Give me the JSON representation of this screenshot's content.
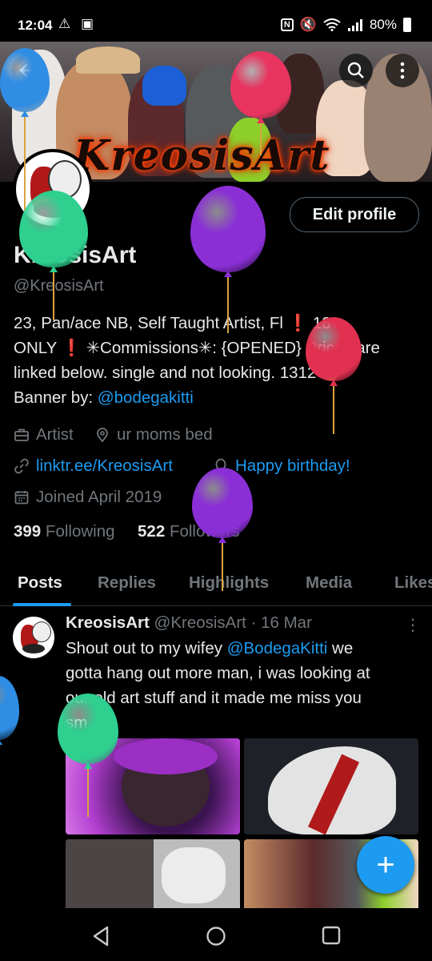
{
  "status_bar": {
    "time": "12:04",
    "left_icons": "⚠ ▣",
    "nfc": "N",
    "battery": "80%"
  },
  "banner": {
    "title": "KreosisArt",
    "back_icon": "back-arrow-icon",
    "search_icon": "search-icon",
    "more_icon": "more-icon"
  },
  "profile": {
    "display_name": "KreosisArt",
    "handle": "@KreosisArt",
    "edit_label": "Edit profile",
    "bio_line1": "23, Pan/ace NB, Self Taught Artist, Fl",
    "bio_line1_b": "❗ 18+",
    "bio_line2": "ONLY ❗ ✳Commissions✳: {OPENED} Prices are",
    "bio_line3": "linked below. single and not looking. 1312 ✊",
    "bio_banner_prefix": "Banner by: ",
    "bio_banner_link": "@bodegakitti",
    "category": "Artist",
    "location": "ur moms bed",
    "website": "linktr.ee/KreosisArt",
    "birthday": "Happy birthday!",
    "joined": "Joined April 2019",
    "following_count": "399",
    "following_label": "Following",
    "followers_count": "522",
    "followers_label": "Followers"
  },
  "tabs": [
    "Posts",
    "Replies",
    "Highlights",
    "Media",
    "Likes"
  ],
  "tweet": {
    "name": "KreosisArt",
    "meta": "@KreosisArt · 16 Mar",
    "text_line1": "Shout out to my wifey ",
    "mention": "@BodegaKitti",
    "text_line1_end": " we",
    "text_line2": "gotta hang out more man, i was looking at",
    "text_line3": "our old art stuff and it made me miss you",
    "text_line4": "sm 😭"
  },
  "fab": {
    "label": "+"
  },
  "colors": {
    "accent": "#1d9bf0",
    "background": "#000000",
    "muted": "#71767b"
  }
}
